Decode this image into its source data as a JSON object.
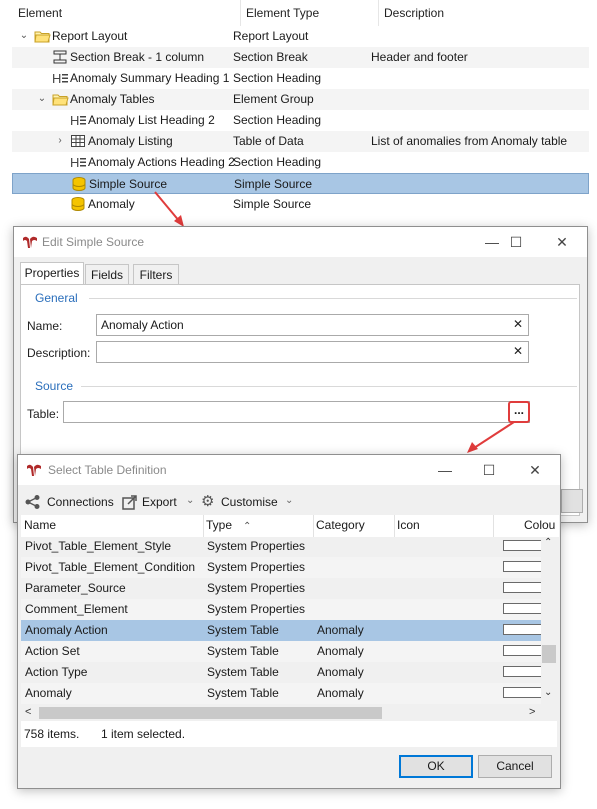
{
  "tree": {
    "columns": [
      "Element",
      "Element Type",
      "Description"
    ],
    "rows": [
      {
        "indent": 0,
        "toggle": "open",
        "icon": "folder-open-icon",
        "name": "Report Layout",
        "type": "Report Layout",
        "desc": ""
      },
      {
        "indent": 1,
        "toggle": "",
        "icon": "section-break-icon",
        "name": "Section Break - 1 column",
        "type": "Section Break",
        "desc": "Header and footer"
      },
      {
        "indent": 1,
        "toggle": "",
        "icon": "heading-icon",
        "name": "Anomaly Summary Heading 1",
        "type": "Section Heading",
        "desc": ""
      },
      {
        "indent": 1,
        "toggle": "open",
        "icon": "folder-open-icon",
        "name": "Anomaly Tables",
        "type": "Element Group",
        "desc": ""
      },
      {
        "indent": 2,
        "toggle": "",
        "icon": "heading-icon",
        "name": "Anomaly List Heading 2",
        "type": "Section Heading",
        "desc": ""
      },
      {
        "indent": 2,
        "toggle": "closed",
        "icon": "table-icon",
        "name": "Anomaly Listing",
        "type": "Table of Data",
        "desc": "List of anomalies from Anomaly table"
      },
      {
        "indent": 2,
        "toggle": "",
        "icon": "heading-icon",
        "name": "Anomaly Actions Heading 2",
        "type": "Section Heading",
        "desc": ""
      },
      {
        "indent": 2,
        "toggle": "",
        "icon": "database-icon",
        "name": "Simple Source",
        "type": "Simple Source",
        "desc": "",
        "selected": true
      },
      {
        "indent": 2,
        "toggle": "",
        "icon": "database-icon",
        "name": "Anomaly",
        "type": "Simple Source",
        "desc": ""
      }
    ]
  },
  "edit_dialog": {
    "title": "Edit Simple Source",
    "tabs": [
      "Properties",
      "Fields",
      "Filters"
    ],
    "general_label": "General",
    "name_label": "Name:",
    "name_value": "Anomaly Action",
    "description_label": "Description:",
    "description_value": "",
    "source_label": "Source",
    "table_label": "Table:",
    "table_value": "",
    "browse_label": "..."
  },
  "select_dialog": {
    "title": "Select Table Definition",
    "toolbar": {
      "connections": "Connections",
      "export": "Export",
      "customise": "Customise"
    },
    "columns": [
      "Name",
      "Type",
      "Category",
      "Icon",
      "Colou"
    ],
    "rows": [
      {
        "name": "Pivot_Table_Element_Style",
        "type": "System Properties",
        "category": ""
      },
      {
        "name": "Pivot_Table_Element_Condition",
        "type": "System Properties",
        "category": ""
      },
      {
        "name": "Parameter_Source",
        "type": "System Properties",
        "category": ""
      },
      {
        "name": "Comment_Element",
        "type": "System Properties",
        "category": ""
      },
      {
        "name": "Anomaly Action",
        "type": "System Table",
        "category": "Anomaly",
        "selected": true
      },
      {
        "name": "Action Set",
        "type": "System Table",
        "category": "Anomaly"
      },
      {
        "name": "Action Type",
        "type": "System Table",
        "category": "Anomaly"
      },
      {
        "name": "Anomaly",
        "type": "System Table",
        "category": "Anomaly"
      }
    ],
    "status_count": "758 items.",
    "status_selected": "1 item selected.",
    "ok_label": "OK",
    "cancel_label": "Cancel"
  },
  "colors": {
    "selection": "#a8c6e4",
    "link_blue": "#2a6ebb",
    "annotation_red": "#e03c3c",
    "primary_border": "#0078d7"
  }
}
